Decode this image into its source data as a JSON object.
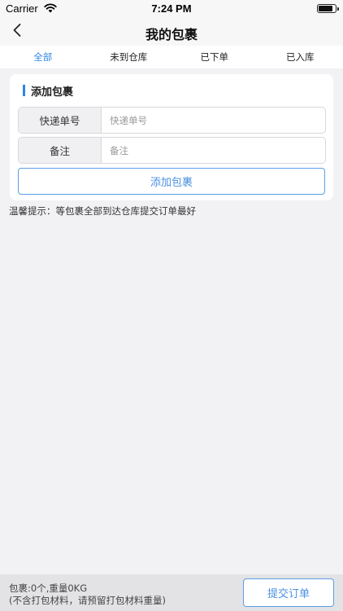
{
  "status_bar": {
    "carrier": "Carrier",
    "time": "7:24 PM"
  },
  "nav": {
    "title": "我的包裹",
    "back_icon": "chevron-left-icon"
  },
  "tabs": [
    {
      "label": "全部",
      "active": true
    },
    {
      "label": "未到仓库",
      "active": false
    },
    {
      "label": "已下单",
      "active": false
    },
    {
      "label": "已入库",
      "active": false
    }
  ],
  "add_card": {
    "title": "添加包裹",
    "tracking_label": "快递单号",
    "tracking_placeholder": "快递单号",
    "tracking_value": "",
    "note_label": "备注",
    "note_placeholder": "备注",
    "note_value": "",
    "add_button_label": "添加包裹"
  },
  "tip": "温馨提示：等包裹全部到达仓库提交订单最好",
  "bottom": {
    "summary": "包裹:0个,重量0KG",
    "note": "(不含打包材料，请预留打包材料重量)",
    "submit_label": "提交订单"
  },
  "colors": {
    "accent": "#2f86e0",
    "button_border": "#5b9ee6",
    "background": "#f2f2f5"
  }
}
